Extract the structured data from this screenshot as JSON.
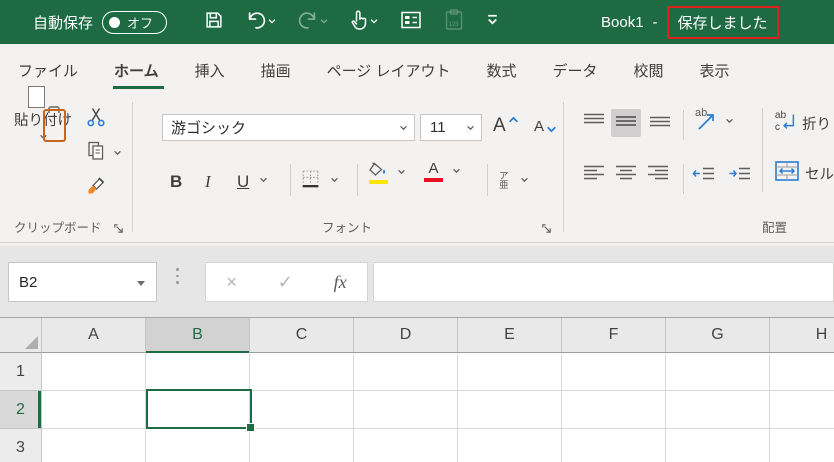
{
  "titlebar": {
    "autosave_label": "自動保存",
    "autosave_state": "オフ",
    "workbook_name": "Book1",
    "separator": "-",
    "save_status": "保存しました",
    "qat_paste_badge": "123",
    "colors": {
      "background": "#1E6B43",
      "annotation_red": "#E0201D"
    }
  },
  "tabs": [
    {
      "label": "ファイル"
    },
    {
      "label": "ホーム"
    },
    {
      "label": "挿入"
    },
    {
      "label": "描画"
    },
    {
      "label": "ページ レイアウト"
    },
    {
      "label": "数式"
    },
    {
      "label": "データ"
    },
    {
      "label": "校閲"
    },
    {
      "label": "表示"
    }
  ],
  "ribbon": {
    "clipboard": {
      "label": "クリップボード",
      "paste": "貼り付け"
    },
    "font": {
      "label": "フォント",
      "name": "游ゴシック",
      "size": "11",
      "bold": "B",
      "italic": "I",
      "underline": "U",
      "grow_letter": "A",
      "shrink_letter": "A",
      "font_color_letter": "A",
      "phonetic_top": "ア",
      "phonetic_bottom": "亜"
    },
    "alignment": {
      "label": "配置",
      "orientation": "ab",
      "wrap_line1": "ab",
      "wrap_line2": "c",
      "wrap_text": "折り",
      "merge_text": "セル"
    },
    "accent_green": "#1F6B45",
    "accent_blue": "#2B7CD3",
    "fill_yellow": "#FFE600",
    "font_red": "#E81123"
  },
  "formula_bar": {
    "name_box": "B2",
    "cancel": "×",
    "enter": "✓",
    "fx": "fx",
    "value": ""
  },
  "grid": {
    "columns": [
      "A",
      "B",
      "C",
      "D",
      "E",
      "F",
      "G",
      "H"
    ],
    "rows": [
      "1",
      "2",
      "3"
    ],
    "active_cell": "B2",
    "selected_column": "B",
    "selected_row": "2"
  }
}
